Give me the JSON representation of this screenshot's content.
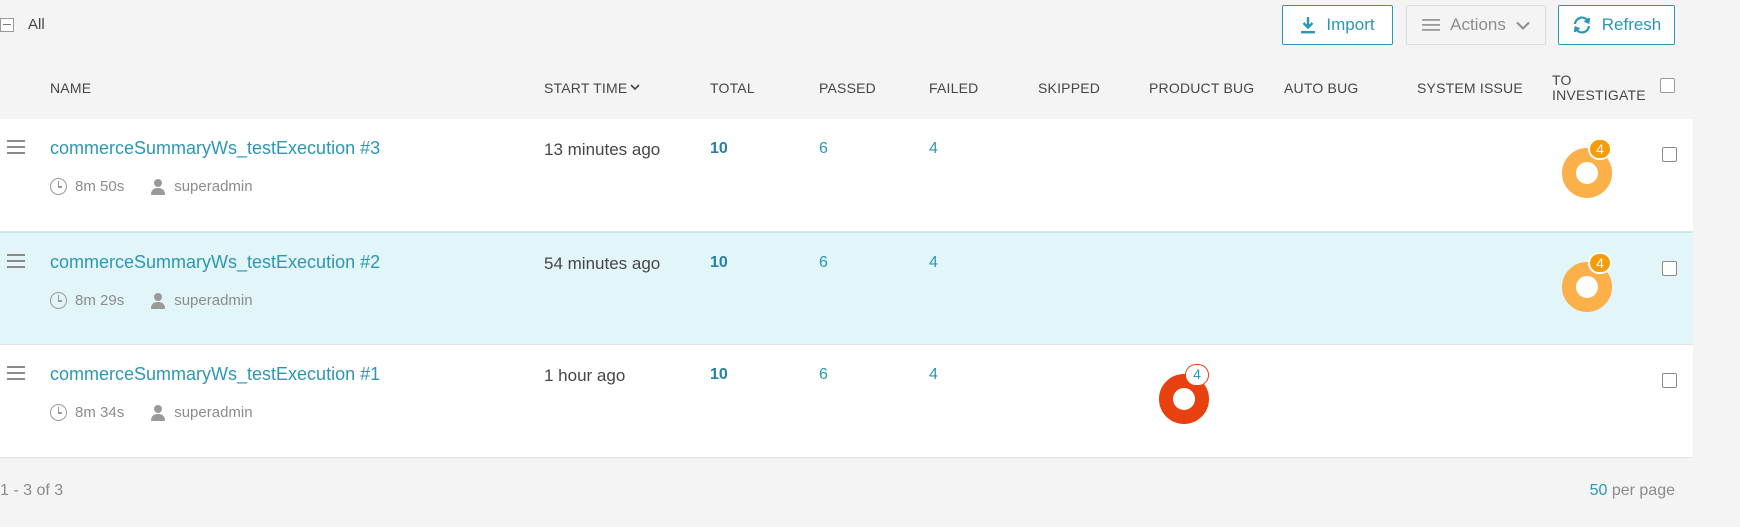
{
  "toolbar": {
    "all_label": "All",
    "import_label": "Import",
    "actions_label": "Actions",
    "refresh_label": "Refresh"
  },
  "columns": {
    "name": "NAME",
    "start_time": "START TIME",
    "total": "TOTAL",
    "passed": "PASSED",
    "failed": "FAILED",
    "skipped": "SKIPPED",
    "product_bug": "PRODUCT BUG",
    "auto_bug": "AUTO BUG",
    "system_issue": "SYSTEM ISSUE",
    "to_investigate": "TO INVESTIGATE"
  },
  "rows": [
    {
      "name": "commerceSummaryWs_testExecution #3",
      "duration": "8m 50s",
      "owner": "superadmin",
      "start_time": "13 minutes ago",
      "total": "10",
      "passed": "6",
      "failed": "4",
      "to_investigate": "4",
      "product_bug": ""
    },
    {
      "name": "commerceSummaryWs_testExecution #2",
      "duration": "8m 29s",
      "owner": "superadmin",
      "start_time": "54 minutes ago",
      "total": "10",
      "passed": "6",
      "failed": "4",
      "to_investigate": "4",
      "product_bug": ""
    },
    {
      "name": "commerceSummaryWs_testExecution #1",
      "duration": "8m 34s",
      "owner": "superadmin",
      "start_time": "1 hour ago",
      "total": "10",
      "passed": "6",
      "failed": "4",
      "to_investigate": "",
      "product_bug": "4"
    }
  ],
  "footer": {
    "count": "1 - 3 of 3",
    "per_page_value": "50",
    "per_page_label": "per page"
  },
  "colors": {
    "accent": "#2b97b6",
    "to_investigate": "#fbb04a",
    "product_bug": "#e8400f",
    "selected_row": "#e2f5f8"
  }
}
